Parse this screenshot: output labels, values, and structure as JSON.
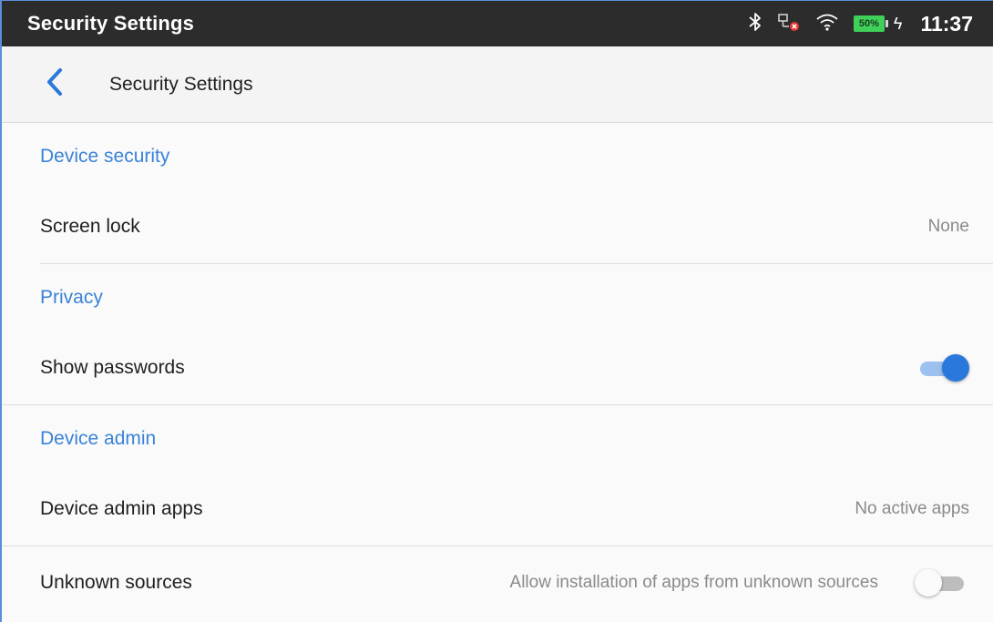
{
  "status_bar": {
    "title": "Security Settings",
    "battery_percent": "50%",
    "time": "11:37",
    "icons": [
      "bluetooth-icon",
      "network-disconnected-icon",
      "wifi-icon",
      "battery-icon",
      "charging-icon"
    ]
  },
  "toolbar": {
    "title": "Security Settings",
    "back_icon": "chevron-left-icon"
  },
  "sections": {
    "device_security": {
      "header": "Device security",
      "screen_lock": {
        "label": "Screen lock",
        "value": "None"
      }
    },
    "privacy": {
      "header": "Privacy",
      "show_passwords": {
        "label": "Show passwords",
        "enabled": true
      }
    },
    "device_admin": {
      "header": "Device admin",
      "device_admin_apps": {
        "label": "Device admin apps",
        "value": "No active apps"
      },
      "unknown_sources": {
        "label": "Unknown sources",
        "summary": "Allow installation of apps from unknown sources",
        "enabled": false
      }
    }
  },
  "colors": {
    "accent": "#2b78dc",
    "section_header": "#3a83d8",
    "status_bar_bg": "#2c2c2c",
    "battery": "#3fd05a"
  }
}
